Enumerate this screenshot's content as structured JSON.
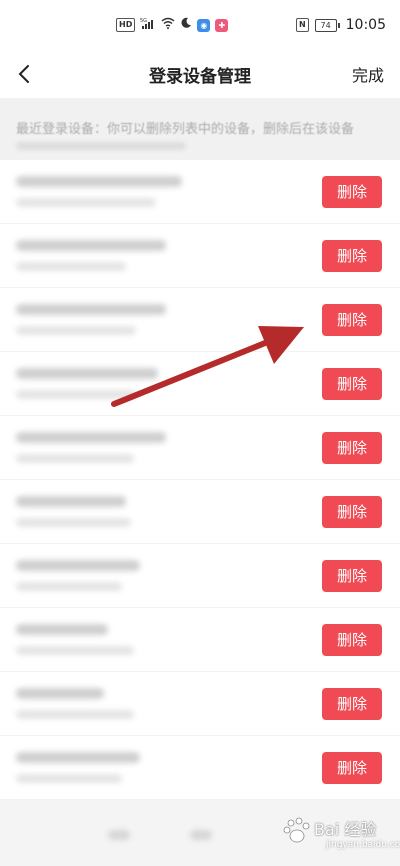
{
  "status_bar": {
    "icons": [
      "HD",
      "5G",
      "wifi",
      "moon",
      "app-badge",
      "app-badge-2"
    ],
    "nfc": "N",
    "battery": "74",
    "time": "10:05"
  },
  "header": {
    "title": "登录设备管理",
    "done_label": "完成"
  },
  "notice": {
    "text": "最近登录设备：你可以删除列表中的设备，删除后在该设备"
  },
  "devices": [
    {
      "delete_label": "删除"
    },
    {
      "delete_label": "删除"
    },
    {
      "delete_label": "删除"
    },
    {
      "delete_label": "删除"
    },
    {
      "delete_label": "删除"
    },
    {
      "delete_label": "删除"
    },
    {
      "delete_label": "删除"
    },
    {
      "delete_label": "删除"
    },
    {
      "delete_label": "删除"
    },
    {
      "delete_label": "删除"
    }
  ],
  "watermark": {
    "text": "Bai 经验",
    "sub": "jingyan.baidu.com"
  },
  "colors": {
    "delete_button": "#f04a54",
    "arrow": "#b52a2a"
  }
}
